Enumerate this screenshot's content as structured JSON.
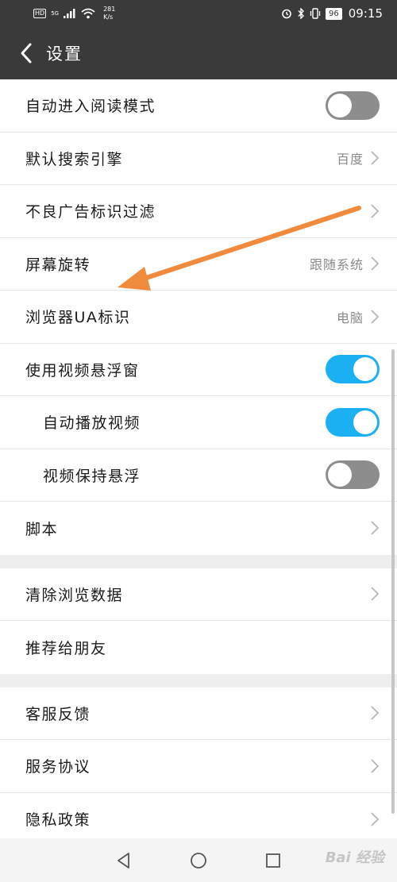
{
  "status_bar": {
    "hd": "HD",
    "network": "5G",
    "speed_value": "281",
    "speed_unit": "K/s",
    "battery": "96",
    "time": "09:15"
  },
  "header": {
    "title": "设置",
    "back_icon": "chevron-left-icon"
  },
  "settings": {
    "reading_mode": {
      "label": "自动进入阅读模式",
      "toggle": "off"
    },
    "search_engine": {
      "label": "默认搜索引擎",
      "value": "百度"
    },
    "ad_filter": {
      "label": "不良广告标识过滤"
    },
    "rotation": {
      "label": "屏幕旋转",
      "value": "跟随系统"
    },
    "ua": {
      "label": "浏览器UA标识",
      "value": "电脑"
    },
    "floating_video": {
      "label": "使用视频悬浮窗",
      "toggle": "on"
    },
    "autoplay": {
      "label": "自动播放视频",
      "toggle": "on"
    },
    "keep_floating": {
      "label": "视频保持悬浮",
      "toggle": "off"
    },
    "script": {
      "label": "脚本"
    },
    "clear_data": {
      "label": "清除浏览数据"
    },
    "recommend": {
      "label": "推荐给朋友"
    },
    "feedback": {
      "label": "客服反馈"
    },
    "terms": {
      "label": "服务协议"
    },
    "privacy": {
      "label": "隐私政策"
    }
  },
  "colors": {
    "header_bg": "#3a3a3a",
    "toggle_on": "#1ab0f2",
    "toggle_off": "#8d8d8d",
    "annotation_arrow": "#f08a3c"
  },
  "navigation": {
    "back": "triangle-back-icon",
    "home": "circle-home-icon",
    "recents": "square-recents-icon"
  },
  "watermark": "Bai 经验"
}
